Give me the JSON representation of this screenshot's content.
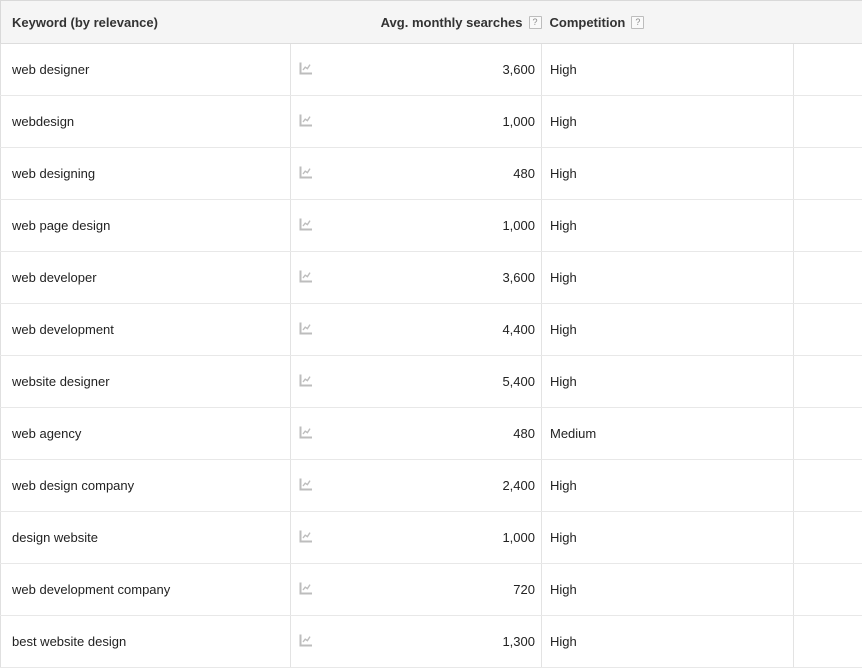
{
  "table": {
    "columns": [
      {
        "key": "keyword",
        "label": "Keyword (by relevance)",
        "help": null
      },
      {
        "key": "spark",
        "label": "",
        "help": null
      },
      {
        "key": "searches",
        "label": "Avg. monthly searches",
        "help": "?"
      },
      {
        "key": "competition",
        "label": "Competition",
        "help": "?"
      },
      {
        "key": "extra",
        "label": "",
        "help": null
      }
    ],
    "rows": [
      {
        "keyword": "web designer",
        "trend_icon": "line-chart-icon",
        "searches": "3,600",
        "competition": "High",
        "extra": ""
      },
      {
        "keyword": "webdesign",
        "trend_icon": "line-chart-icon",
        "searches": "1,000",
        "competition": "High",
        "extra": ""
      },
      {
        "keyword": "web designing",
        "trend_icon": "line-chart-icon",
        "searches": "480",
        "competition": "High",
        "extra": ""
      },
      {
        "keyword": "web page design",
        "trend_icon": "line-chart-icon",
        "searches": "1,000",
        "competition": "High",
        "extra": ""
      },
      {
        "keyword": "web developer",
        "trend_icon": "line-chart-icon",
        "searches": "3,600",
        "competition": "High",
        "extra": ""
      },
      {
        "keyword": "web development",
        "trend_icon": "line-chart-icon",
        "searches": "4,400",
        "competition": "High",
        "extra": ""
      },
      {
        "keyword": "website designer",
        "trend_icon": "line-chart-icon",
        "searches": "5,400",
        "competition": "High",
        "extra": ""
      },
      {
        "keyword": "web agency",
        "trend_icon": "line-chart-icon",
        "searches": "480",
        "competition": "Medium",
        "extra": ""
      },
      {
        "keyword": "web design company",
        "trend_icon": "line-chart-icon",
        "searches": "2,400",
        "competition": "High",
        "extra": ""
      },
      {
        "keyword": "design website",
        "trend_icon": "line-chart-icon",
        "searches": "1,000",
        "competition": "High",
        "extra": ""
      },
      {
        "keyword": "web development company",
        "trend_icon": "line-chart-icon",
        "searches": "720",
        "competition": "High",
        "extra": ""
      },
      {
        "keyword": "best website design",
        "trend_icon": "line-chart-icon",
        "searches": "1,300",
        "competition": "High",
        "extra": ""
      }
    ]
  },
  "colors": {
    "header_background": "#f5f5f5",
    "header_text": "#333333",
    "body_text": "#222222",
    "row_border": "#e8e8e8",
    "outer_border": "#d9d9d9",
    "icon_gray": "#bdbdbd"
  }
}
